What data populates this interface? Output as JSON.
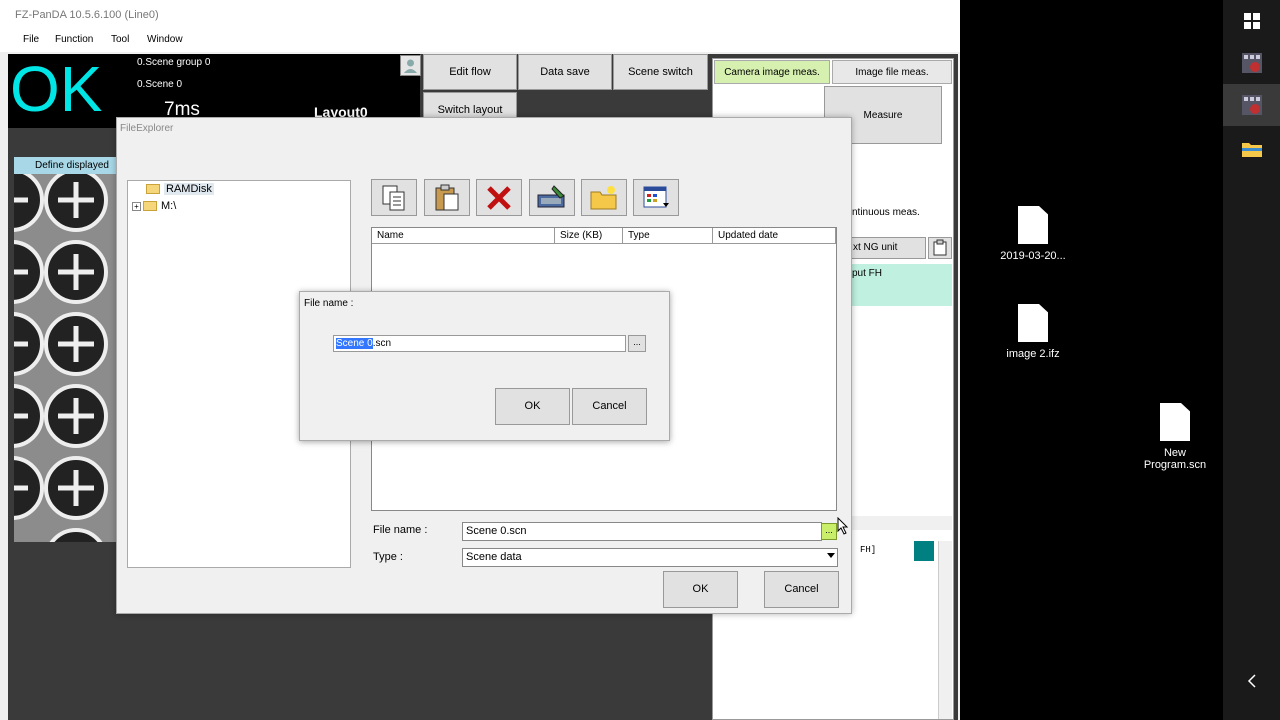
{
  "app": {
    "title": "FZ-PanDA 10.5.6.100 (Line0)",
    "menu": [
      "File",
      "Function",
      "Tool",
      "Window"
    ],
    "status": {
      "result": "OK",
      "scene_group": "0.Scene group 0",
      "scene": "0.Scene 0",
      "time": "7ms",
      "layout": "Layout0"
    },
    "toolbar": {
      "edit_flow": "Edit flow",
      "data_save": "Data save",
      "scene_switch": "Scene switch",
      "switch_layout": "Switch layout"
    },
    "right_panel": {
      "tab_camera": "Camera image meas.",
      "tab_file": "Image file meas.",
      "measure": "Measure",
      "continuous": "ntinuous meas.",
      "next_ng": "xt NG unit",
      "output_fh": "put FH",
      "fh_text": "FH]"
    },
    "image_window": {
      "label": "Define displayed"
    }
  },
  "file_explorer": {
    "title": "FileExplorer",
    "tree": [
      "RAMDisk",
      "M:\\"
    ],
    "tree_expander": "+",
    "columns": [
      "Name",
      "Size (KB)",
      "Type",
      "Updated date"
    ],
    "file_name_label": "File name :",
    "file_name_value": "Scene 0.scn",
    "browse_label": "...",
    "type_label": "Type :",
    "type_value": "Scene data",
    "ok": "OK",
    "cancel": "Cancel"
  },
  "file_name_dialog": {
    "title": "File name :",
    "selected_text": "Scene 0",
    "rest_text": ".scn",
    "browse_label": "...",
    "ok": "OK",
    "cancel": "Cancel"
  },
  "desktop": {
    "icons": [
      "2019-03-20...",
      "image 2.ifz",
      "New Program.scn"
    ]
  },
  "colors": {
    "ok_text": "#00e5e5",
    "accent_green": "#c8ee6a",
    "teal": "#008080",
    "selection": "#3377ff"
  }
}
